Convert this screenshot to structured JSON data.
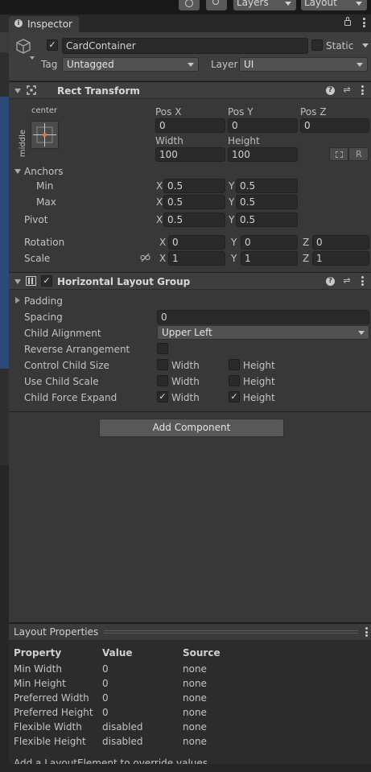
{
  "toolbar": {
    "layers_label": "Layers",
    "layout_label": "Layout"
  },
  "tab": {
    "title": "Inspector"
  },
  "object": {
    "active": true,
    "name": "CardContainer",
    "static_label": "Static",
    "static_checked": false,
    "tag_label": "Tag",
    "tag_value": "Untagged",
    "layer_label": "Layer",
    "layer_value": "UI"
  },
  "rect_transform": {
    "title": "Rect Transform",
    "anchor_h": "center",
    "anchor_v": "middle",
    "pos_x_label": "Pos X",
    "pos_y_label": "Pos Y",
    "pos_z_label": "Pos Z",
    "pos_x": "0",
    "pos_y": "0",
    "pos_z": "0",
    "width_label": "Width",
    "height_label": "Height",
    "width": "100",
    "height": "100",
    "r_button": "R",
    "anchors_label": "Anchors",
    "min_label": "Min",
    "max_label": "Max",
    "pivot_label": "Pivot",
    "min_x": "0.5",
    "min_y": "0.5",
    "max_x": "0.5",
    "max_y": "0.5",
    "pivot_x": "0.5",
    "pivot_y": "0.5",
    "rotation_label": "Rotation",
    "scale_label": "Scale",
    "rot_x": "0",
    "rot_y": "0",
    "rot_z": "0",
    "scale_x": "1",
    "scale_y": "1",
    "scale_z": "1",
    "axis_x": "X",
    "axis_y": "Y",
    "axis_z": "Z"
  },
  "layout_group": {
    "title": "Horizontal Layout Group",
    "enabled": true,
    "padding_label": "Padding",
    "spacing_label": "Spacing",
    "spacing": "0",
    "child_alignment_label": "Child Alignment",
    "child_alignment": "Upper Left",
    "reverse_label": "Reverse Arrangement",
    "control_size_label": "Control Child Size",
    "use_scale_label": "Use Child Scale",
    "force_expand_label": "Child Force Expand",
    "width_label": "Width",
    "height_label": "Height",
    "reverse_checked": false,
    "control_width": false,
    "control_height": false,
    "scale_width": false,
    "scale_height": false,
    "expand_width": true,
    "expand_height": true
  },
  "add_component_label": "Add Component",
  "layout_properties": {
    "title": "Layout Properties",
    "headers": [
      "Property",
      "Value",
      "Source"
    ],
    "rows": [
      [
        "Min Width",
        "0",
        "none"
      ],
      [
        "Min Height",
        "0",
        "none"
      ],
      [
        "Preferred Width",
        "0",
        "none"
      ],
      [
        "Preferred Height",
        "0",
        "none"
      ],
      [
        "Flexible Width",
        "disabled",
        "none"
      ],
      [
        "Flexible Height",
        "disabled",
        "none"
      ]
    ],
    "footer_note": "Add a LayoutElement to override values"
  },
  "colors": {
    "panel_bg": "#383838",
    "header_bg": "#3e3e3e",
    "field_bg": "#2a2a2a",
    "accent_blue": "#3a5a8c",
    "pivot_orange": "#e0783a"
  }
}
